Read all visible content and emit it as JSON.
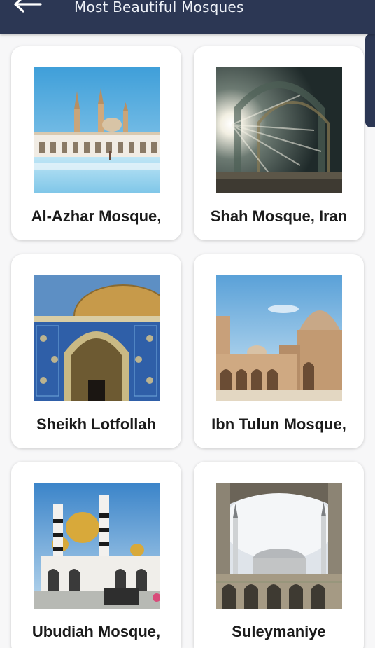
{
  "appbar": {
    "title": "Most Beautiful Mosques",
    "back_icon": "arrow-left-icon",
    "bg_color": "#2c3754"
  },
  "mosques": [
    {
      "name": "Al-Azhar Mosque,"
    },
    {
      "name": "Shah Mosque, Iran"
    },
    {
      "name": "Sheikh Lotfollah"
    },
    {
      "name": "Ibn Tulun Mosque,"
    },
    {
      "name": "Ubudiah Mosque,"
    },
    {
      "name": "Suleymaniye"
    }
  ]
}
